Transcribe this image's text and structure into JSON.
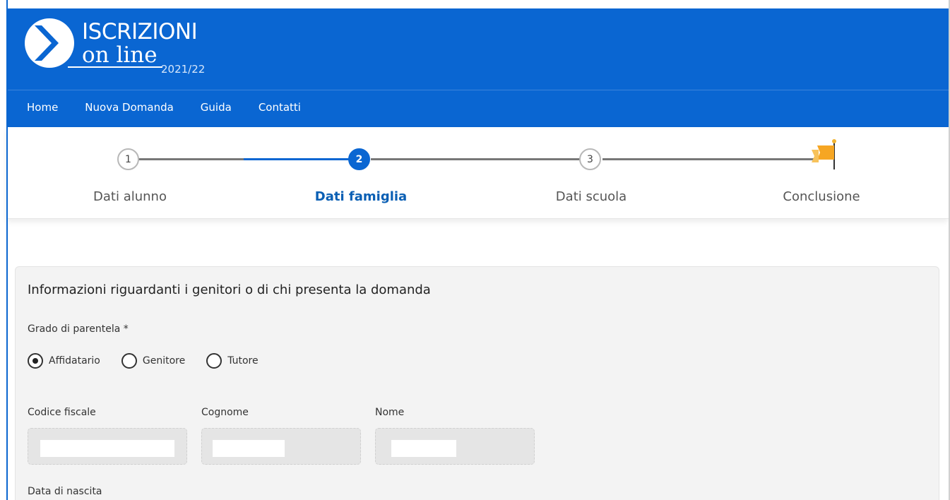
{
  "header": {
    "logo_title": "ISCRIZIONI",
    "logo_subtitle": "on line",
    "logo_year": "2021/22",
    "brand_color": "#0a66d2"
  },
  "nav": {
    "items": [
      {
        "label": "Home"
      },
      {
        "label": "Nuova Domanda"
      },
      {
        "label": "Guida"
      },
      {
        "label": "Contatti"
      }
    ]
  },
  "stepper": {
    "steps": [
      {
        "number": "1",
        "label": "Dati alunno",
        "state": "done"
      },
      {
        "number": "2",
        "label": "Dati famiglia",
        "state": "current"
      },
      {
        "number": "3",
        "label": "Dati scuola",
        "state": "todo"
      },
      {
        "number": "",
        "label": "Conclusione",
        "state": "todo",
        "icon": "flag-icon"
      }
    ]
  },
  "form": {
    "section_title": "Informazioni riguardanti i genitori o di chi presenta la domanda",
    "relationship": {
      "label": "Grado di parentela *",
      "options": [
        {
          "label": "Affidatario",
          "checked": true
        },
        {
          "label": "Genitore",
          "checked": false
        },
        {
          "label": "Tutore",
          "checked": false
        }
      ]
    },
    "fields": {
      "codice_fiscale": {
        "label": "Codice fiscale",
        "value": ""
      },
      "cognome": {
        "label": "Cognome",
        "value": ""
      },
      "nome": {
        "label": "Nome",
        "value": ""
      },
      "data_nascita": {
        "label": "Data di nascita"
      }
    }
  }
}
